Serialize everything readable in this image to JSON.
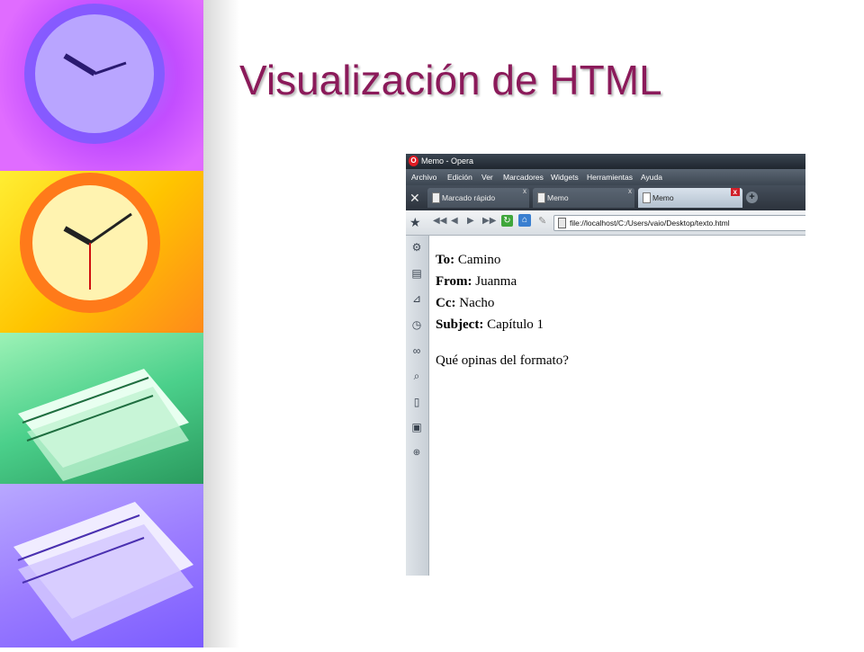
{
  "slide": {
    "title": "Visualización de HTML"
  },
  "browser": {
    "window_title": "Memo - Opera",
    "menu": [
      "Archivo",
      "Edición",
      "Ver",
      "Marcadores",
      "Widgets",
      "Herramientas",
      "Ayuda"
    ],
    "tabs": [
      {
        "label": "Marcado rápido",
        "close": "x"
      },
      {
        "label": "Memo",
        "close": "x"
      },
      {
        "label": "Memo",
        "close": "x",
        "active": true
      }
    ],
    "address": "file://localhost/C:/Users/vaio/Desktop/texto.html",
    "icons": {
      "panel": "star-icon",
      "side": [
        "gear-icon",
        "chat-icon",
        "feed-icon",
        "history-icon",
        "link-icon",
        "search-icon",
        "notes-icon",
        "transfers-icon",
        "add-icon"
      ]
    }
  },
  "memo": {
    "to_label": "To:",
    "to_value": "Camino",
    "from_label": "From:",
    "from_value": "Juanma",
    "cc_label": "Cc:",
    "cc_value": "Nacho",
    "subject_label": "Subject:",
    "subject_value": "Capítulo 1",
    "message": "Qué opinas del formato?"
  }
}
